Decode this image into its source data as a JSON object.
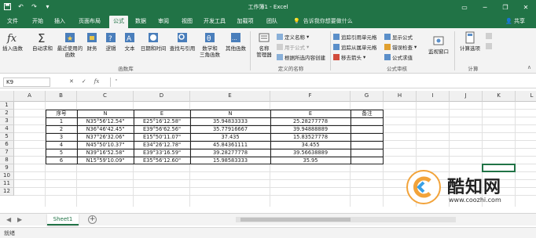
{
  "titlebar": {
    "title": "工作簿1 - Excel",
    "quick_access": [
      "save-icon",
      "undo-icon",
      "redo-icon",
      "customize-icon"
    ],
    "window_controls": [
      "ribbon-display-icon",
      "minimize-icon",
      "restore-icon",
      "close-icon"
    ]
  },
  "tabs": {
    "items": [
      "文件",
      "开始",
      "插入",
      "页面布局",
      "公式",
      "数据",
      "审阅",
      "视图",
      "开发工具",
      "加载项",
      "团队"
    ],
    "active": "公式",
    "tell_me": "告诉我你想要做什么",
    "share": "共享"
  },
  "ribbon": {
    "function_library": {
      "insert_function": "插入函数",
      "autosum": "自动求和",
      "recent_line1": "最近使用的",
      "recent_line2": "函数",
      "financial": "财务",
      "logical": "逻辑",
      "text": "文本",
      "datetime": "日期和时间",
      "lookup": "查找与引用",
      "math_line1": "数学和",
      "math_line2": "三角函数",
      "more": "其他函数",
      "group_label": "函数库"
    },
    "defined_names": {
      "name_manager_line1": "名称",
      "name_manager_line2": "管理器",
      "define_name": "定义名称",
      "use_in_formula": "用于公式",
      "create_from_selection": "根据所选内容创建",
      "group_label": "定义的名称"
    },
    "formula_auditing": {
      "trace_precedents": "追踪引用单元格",
      "trace_dependents": "追踪从属单元格",
      "remove_arrows": "移去箭头",
      "show_formulas": "显示公式",
      "error_checking": "错误检查",
      "evaluate_formula": "公式求值",
      "group_label": "公式审核"
    },
    "watch_window": "监视窗口",
    "calculation": {
      "options_line1": "计算选项",
      "group_label": "计算"
    }
  },
  "formula_bar": {
    "name_box": "K9",
    "cancel": "✕",
    "enter": "✓",
    "fx": "fx",
    "content": "'"
  },
  "columns": [
    "A",
    "B",
    "C",
    "D",
    "E",
    "F",
    "G",
    "H",
    "I",
    "J",
    "K",
    "L"
  ],
  "rows": [
    "1",
    "2",
    "3",
    "4",
    "5",
    "6",
    "7",
    "8",
    "9",
    "10",
    "11",
    "12"
  ],
  "table": {
    "headers": [
      "序号",
      "N",
      "E",
      "N",
      "E",
      "备注"
    ],
    "rows": [
      [
        "1",
        "N35°56'12.54\"",
        "E25°16'12.58\"",
        "35.94833333",
        "25.28277778",
        ""
      ],
      [
        "2",
        "N36°46'42.45\"",
        "E39°56'62.56\"",
        "35.77916667",
        "39.94888889",
        ""
      ],
      [
        "3",
        "N37°26'32.06\"",
        "E15°50'11.07\"",
        "37.435",
        "15.83527778",
        ""
      ],
      [
        "4",
        "N45°50'10.37\"",
        "E34°26'12.78\"",
        "45.84361111",
        "34.455",
        ""
      ],
      [
        "5",
        "N39°16'52.58\"",
        "E39°33'16.59\"",
        "39.28277778",
        "39.56638889",
        ""
      ],
      [
        "6",
        "N15°59'10.09\"",
        "E35°56'12.60\"",
        "15.98583333",
        "35.95",
        ""
      ]
    ]
  },
  "selected_cell": "K9",
  "sheets": {
    "tabs": [
      "Sheet1"
    ],
    "add_label": "+"
  },
  "status": {
    "mode": "就绪"
  },
  "watermark": {
    "brand": "酷知网",
    "url": "www.coozhi.com"
  },
  "colors": {
    "accent": "#217346",
    "tab_bar": "#217346",
    "ribbon_bg": "#f3f3f3"
  }
}
